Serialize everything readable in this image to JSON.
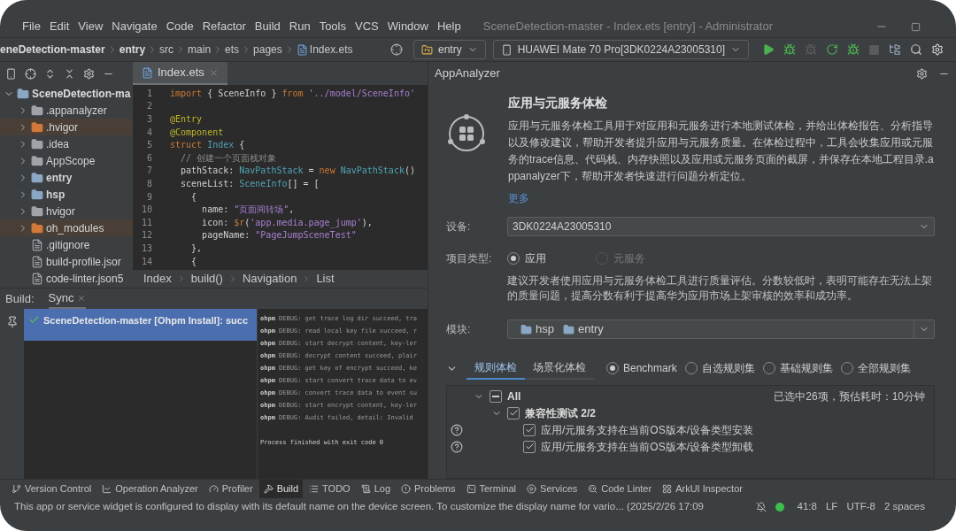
{
  "menu": [
    "File",
    "Edit",
    "View",
    "Navigate",
    "Code",
    "Refactor",
    "Build",
    "Run",
    "Tools",
    "VCS",
    "Window",
    "Help"
  ],
  "window": {
    "title": "SceneDetection-master - Index.ets [entry] - Administrator"
  },
  "breadcrumb": [
    {
      "label": "eneDetection-master",
      "bold": true
    },
    {
      "label": "entry",
      "bold": true
    },
    {
      "label": "src",
      "bold": false
    },
    {
      "label": "main",
      "bold": false
    },
    {
      "label": "ets",
      "bold": false
    },
    {
      "label": "pages",
      "bold": false
    },
    {
      "label": "Index.ets",
      "bold": false,
      "kind": "file"
    }
  ],
  "run_config": "entry",
  "device": "HUAWEI Mate 70 Pro[3DK0224A23005310]",
  "editor_tab": "Index.ets",
  "project_tree": {
    "label": "SceneDetection-ma",
    "expanded": true,
    "children": [
      {
        "label": ".appanalyzer",
        "kind": "folder"
      },
      {
        "label": ".hvigor",
        "kind": "excluded"
      },
      {
        "label": ".idea",
        "kind": "folder"
      },
      {
        "label": "AppScope",
        "kind": "folder"
      },
      {
        "label": "entry",
        "kind": "module"
      },
      {
        "label": "hsp",
        "kind": "module"
      },
      {
        "label": "hvigor",
        "kind": "folder"
      },
      {
        "label": "oh_modules",
        "kind": "excluded"
      },
      {
        "label": ".gitignore",
        "kind": "file"
      },
      {
        "label": "build-profile.jsor",
        "kind": "file"
      },
      {
        "label": "code-linter.json5",
        "kind": "file"
      }
    ]
  },
  "code": [
    {
      "number": "1",
      "segments": [
        {
          "kind": "keyword",
          "text": "import"
        },
        {
          "kind": "plain",
          "text": " { SceneInfo } "
        },
        {
          "kind": "keyword",
          "text": "from"
        },
        {
          "kind": "string",
          "text": " '../model/SceneInfo'"
        }
      ]
    },
    {
      "number": "2"
    },
    {
      "number": "3",
      "segments": [
        {
          "kind": "annotation",
          "text": "@Entry"
        }
      ]
    },
    {
      "number": "4",
      "segments": [
        {
          "kind": "annotation",
          "text": "@Component"
        }
      ]
    },
    {
      "number": "5",
      "segments": [
        {
          "kind": "keyword",
          "text": "struct"
        },
        {
          "kind": "type",
          "text": " Index"
        },
        {
          "kind": "plain",
          "text": " {"
        }
      ]
    },
    {
      "number": "6",
      "segments": [
        {
          "kind": "comment",
          "text": "  // 创建一个页面栈对象"
        }
      ]
    },
    {
      "number": "7",
      "segments": [
        {
          "kind": "plain",
          "text": "  pathStack: "
        },
        {
          "kind": "type",
          "text": "NavPathStack"
        },
        {
          "kind": "plain",
          "text": " = "
        },
        {
          "kind": "keyword",
          "text": "new"
        },
        {
          "kind": "type",
          "text": " NavPathStack"
        },
        {
          "kind": "plain",
          "text": "()"
        }
      ]
    },
    {
      "number": "8",
      "segments": [
        {
          "kind": "plain",
          "text": "  sceneList: "
        },
        {
          "kind": "type",
          "text": "SceneInfo"
        },
        {
          "kind": "plain",
          "text": "[] = ["
        }
      ]
    },
    {
      "number": "9",
      "segments": [
        {
          "kind": "plain",
          "text": "    {"
        }
      ]
    },
    {
      "number": "10",
      "segments": [
        {
          "kind": "plain",
          "text": "      name: "
        },
        {
          "kind": "string",
          "text": "\"页面间转场\""
        },
        {
          "kind": "plain",
          "text": ","
        }
      ]
    },
    {
      "number": "11",
      "segments": [
        {
          "kind": "plain",
          "text": "      icon: "
        },
        {
          "kind": "keyword",
          "text": "$r"
        },
        {
          "kind": "plain",
          "text": "("
        },
        {
          "kind": "string",
          "text": "'app.media.page_jump'"
        },
        {
          "kind": "plain",
          "text": "),"
        }
      ]
    },
    {
      "number": "12",
      "segments": [
        {
          "kind": "plain",
          "text": "      pageName: "
        },
        {
          "kind": "string",
          "text": "\"PageJumpSceneTest\""
        }
      ]
    },
    {
      "number": "13",
      "segments": [
        {
          "kind": "plain",
          "text": "    },"
        }
      ]
    },
    {
      "number": "14",
      "segments": [
        {
          "kind": "plain",
          "text": "    {"
        }
      ]
    }
  ],
  "editor_breadcrumb": [
    "Index",
    "build()",
    "Navigation",
    "List"
  ],
  "build_panel": {
    "label": "Build:",
    "tab": "Sync",
    "tree_item": "SceneDetection-master [Ohpm Install]: succ",
    "console": [
      {
        "tag": "ohpm",
        "text": " DEBUG: get trace log dir succeed, tra"
      },
      {
        "tag": "ohpm",
        "text": " DEBUG: read local key file succeed, r"
      },
      {
        "tag": "ohpm",
        "text": " DEBUG: start decrypt content, key-ler"
      },
      {
        "tag": "ohpm",
        "text": " DEBUG: decrypt content succeed, plair"
      },
      {
        "tag": "ohpm",
        "text": " DEBUG: get key of encrypt succeed, ke"
      },
      {
        "tag": "ohpm",
        "text": " DEBUG: start convert trace data to ev"
      },
      {
        "tag": "ohpm",
        "text": " DEBUG: convert trace data to event su"
      },
      {
        "tag": "ohpm",
        "text": " DEBUG: start encrypt content, key-ler"
      },
      {
        "tag": "ohpm",
        "text": " DEBUG: Audit failed, detail: Invalid"
      }
    ],
    "exit_line": "Process finished with exit code 0"
  },
  "analyzer": {
    "title": "AppAnalyzer",
    "heading": "应用与元服务体检",
    "description": "应用与元服务体检工具用于对应用和元服务进行本地测试体检，并给出体检报告、分析指导以及修改建议，帮助开发者提升应用与元服务质量。在体检过程中，工具会收集应用或元服务的trace信息、代码栈、内存快照以及应用或元服务页面的截屏，并保存在本地工程目录.appanalyzer下，帮助开发者快速进行问题分析定位。",
    "more_link": "更多",
    "device_label": "设备:",
    "device_value": "3DK0224A23005310",
    "type_label": "项目类型:",
    "types": [
      {
        "label": "应用",
        "selected": true,
        "disabled": false
      },
      {
        "label": "元服务",
        "selected": false,
        "disabled": true
      }
    ],
    "type_hint": "建议开发者使用应用与元服务体检工具进行质量评估。分数较低时，表明可能存在无法上架的质量问题，提高分数有利于提高华为应用市场上架审核的效率和成功率。",
    "module_label": "模块:",
    "modules": [
      "hsp",
      "entry"
    ],
    "tabs": [
      {
        "label": "规则体检",
        "selected": true
      },
      {
        "label": "场景化体检",
        "selected": false
      }
    ],
    "rule_sets": [
      {
        "label": "Benchmark",
        "selected": true
      },
      {
        "label": "自选规则集",
        "selected": false
      },
      {
        "label": "基础规则集",
        "selected": false
      },
      {
        "label": "全部规则集",
        "selected": false
      }
    ],
    "summary": "已选中26项，预估耗时：10分钟",
    "rules": {
      "label": "All",
      "checked": true,
      "mixed": true,
      "expanded": true,
      "children": [
        {
          "label": "兼容性测试 2/2",
          "checked": true,
          "expanded": true,
          "children": [
            {
              "label": "应用/元服务支持在当前OS版本/设备类型安装",
              "checked": true
            },
            {
              "label": "应用/元服务支持在当前OS版本/设备类型卸载",
              "checked": true
            }
          ]
        }
      ]
    }
  },
  "tool_windows": [
    {
      "label": "Version Control",
      "kind": "vcs",
      "selected": false
    },
    {
      "label": "Operation Analyzer",
      "kind": "chart",
      "selected": false
    },
    {
      "label": "Profiler",
      "kind": "profiler",
      "selected": false
    },
    {
      "label": "Build",
      "kind": "build",
      "selected": true
    },
    {
      "label": "TODO",
      "kind": "list",
      "selected": false
    },
    {
      "label": "Log",
      "kind": "log",
      "selected": false
    },
    {
      "label": "Problems",
      "kind": "problems",
      "selected": false
    },
    {
      "label": "Terminal",
      "kind": "terminal",
      "selected": false
    },
    {
      "label": "Services",
      "kind": "services",
      "selected": false
    },
    {
      "label": "Code Linter",
      "kind": "linter",
      "selected": false
    },
    {
      "label": "ArkUI Inspector",
      "kind": "inspector",
      "selected": false
    }
  ],
  "status_bar": {
    "message": "This app or service widget is configured to display with its default name on the device screen. To customize the display name for vario... (2025/2/26 17:09",
    "items": [
      "41:8",
      "LF",
      "UTF-8",
      "2 spaces"
    ]
  }
}
